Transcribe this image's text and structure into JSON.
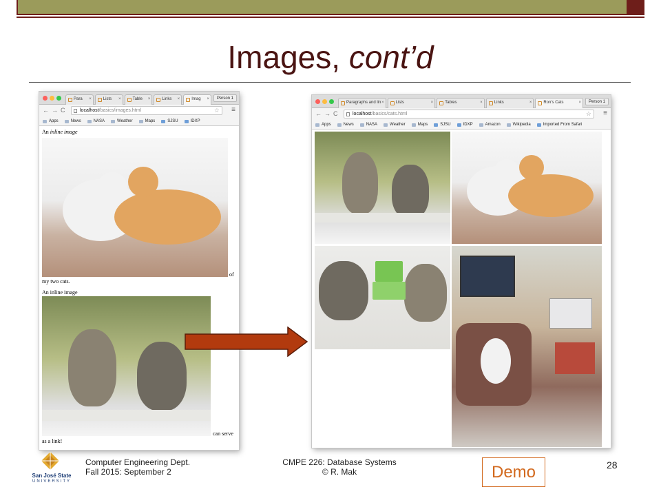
{
  "slide": {
    "title_main": "Images, ",
    "title_italic": "cont’d",
    "page_number": "28",
    "demo_label": "Demo"
  },
  "footer": {
    "dept_line1": "Computer Engineering Dept.",
    "dept_line2": "Fall 2015: September 2",
    "course_line1": "CMPE 226: Database Systems",
    "course_line2": "© R. Mak"
  },
  "logo": {
    "name": "San José State",
    "sub": "UNIVERSITY"
  },
  "browser_left": {
    "tabs": [
      {
        "label": "Para",
        "active": false
      },
      {
        "label": "Lists",
        "active": false
      },
      {
        "label": "Table",
        "active": false
      },
      {
        "label": "Links",
        "active": false
      },
      {
        "label": "Imag",
        "active": true
      }
    ],
    "profile": "Person 1",
    "url_host": "localhost",
    "url_path": "/basics/images.html",
    "bookmarks": [
      "Apps",
      "News",
      "NASA",
      "Weather",
      "Maps",
      "SJSU",
      "IDXP"
    ],
    "content": {
      "caption1_prefix": "An ",
      "caption1_italic": "inline image",
      "text_of": "of",
      "text_my_two_cats": "my two cats.",
      "caption2": "An inline image",
      "text_can_serve": "can serve",
      "text_as_a_link": "as a link!"
    }
  },
  "browser_right": {
    "tabs": [
      {
        "label": "Paragraphs and lin",
        "active": false
      },
      {
        "label": "Lists",
        "active": false
      },
      {
        "label": "Tables",
        "active": false
      },
      {
        "label": "Links",
        "active": false
      },
      {
        "label": "Ron's Cats",
        "active": true
      }
    ],
    "profile": "Person 1",
    "url_host": "localhost",
    "url_path": "/basics/cats.html",
    "bookmarks": [
      "Apps",
      "News",
      "NASA",
      "Weather",
      "Maps",
      "SJSU",
      "IDXP",
      "Amazon",
      "Wikipedia",
      "Imported From Safari"
    ]
  },
  "colors": {
    "title": "#4a1412",
    "band": "#9b9b5b",
    "band_border": "#6e1e1a",
    "arrow_fill": "#b23a0e",
    "demo": "#d2691e"
  }
}
